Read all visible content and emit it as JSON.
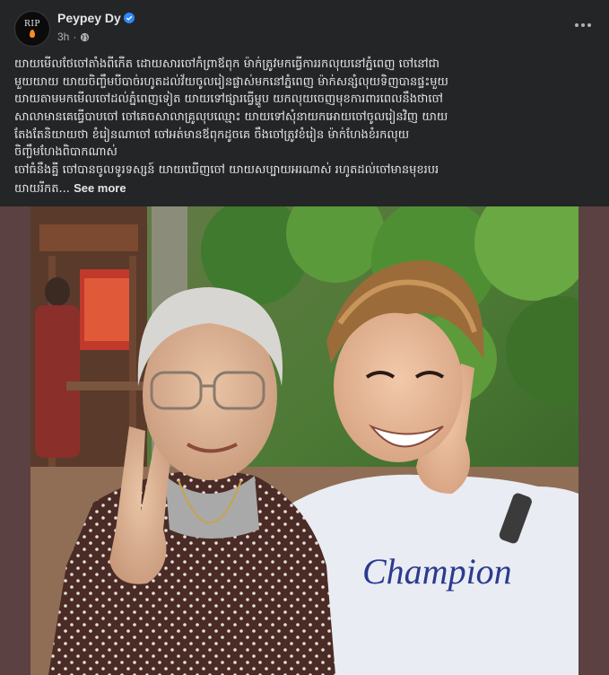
{
  "post": {
    "author": {
      "name": "Peypey Dy",
      "avatar_text": "RIP"
    },
    "timestamp": "3h",
    "separator": "·",
    "icons": {
      "verified": "verified-badge-icon",
      "privacy": "globe-icon",
      "more": "more-horizontal-icon"
    },
    "text_lines": [
      "យាយមើលថែចៅតាំងពីកើត ដោយសារចៅកំព្រាឪពុក ម៉ាក់ត្រូវមកធ្វើការរកលុយនៅភ្នំពេញ ចៅនៅជា",
      "មួយយាយ យាយចិញ្ចឹមបីបាច់រហូតដល់វ័យចូលរៀនផ្លាស់មកនៅភ្នំពេញ ម៉ាក់សន្សំលុយទិញបានផ្ទះមួយ",
      "យាយតាមមកមើលចៅដល់ភ្នំពេញទៀត យាយទៅផ្សារធ្វើម្ហូប យកលុយចេញមុខការពារពេលនឹងថាចៅ",
      "សាលាមានគេធ្វើបាបចៅ ចៅគេចសាលាគ្រូលុបឈ្មោះ យាយទៅសុំនាយកអោយចៅចូលរៀនវិញ យាយ",
      "តែងតែនិយាយថា ខំរៀនណាចៅ ចៅអត់មានឪពុកដូចគេ ចឹងចៅត្រូវខំរៀន ម៉ាក់ហែងខំរកលុយ",
      "ចិញ្ចឹមហែងពិបាកណាស់",
      "ចៅធំនឹងគ្នី ចៅបានចូលទូរទស្សន៍ យាយឃើញចៅ យាយសប្បាយអរណាស់ រហូតដល់ចៅមានមុខរបរ"
    ],
    "last_line": "យាយរីកត...",
    "see_more_label": "See more",
    "photo": {
      "description_text": "",
      "shirt_text": "Champion"
    }
  },
  "colors": {
    "background": "#242526",
    "text_primary": "#e4e6eb",
    "text_secondary": "#b0b3b8",
    "verified_blue": "#2d88ff",
    "media_frame": "#5b4141"
  }
}
